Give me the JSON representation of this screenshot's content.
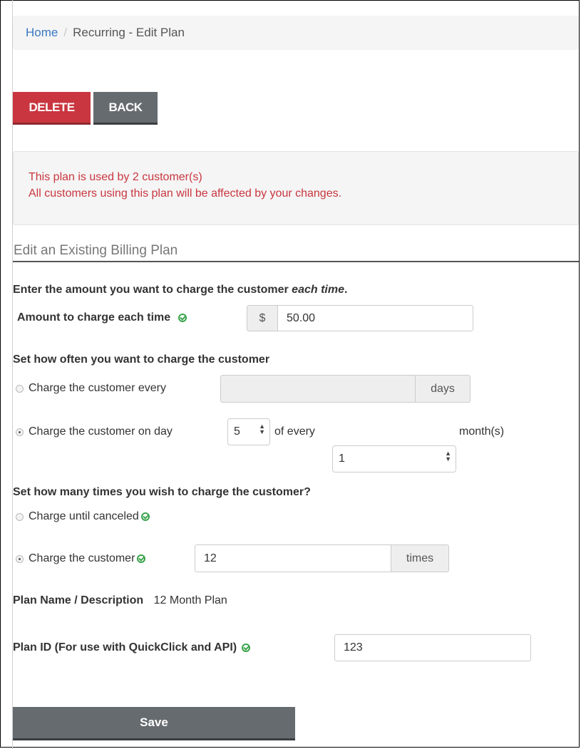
{
  "breadcrumb": {
    "home": "Home",
    "separator": "/",
    "current": "Recurring - Edit Plan"
  },
  "actions": {
    "delete_label": "DELETE",
    "back_label": "BACK"
  },
  "alert": {
    "line1": "This plan is used by 2 customer(s)",
    "line2": "All customers using this plan will be affected by your changes."
  },
  "form": {
    "title": "Edit an Existing Billing Plan",
    "amount_section": {
      "heading_prefix": "Enter the amount you want to charge the customer ",
      "heading_emphasis": "each time",
      "heading_suffix": ".",
      "label": "Amount to charge each time",
      "currency": "$",
      "value": "50.00"
    },
    "frequency_section": {
      "heading": "Set how often you want to charge the customer",
      "option_days": {
        "label": "Charge the customer every",
        "value": "",
        "unit": "days",
        "selected": false
      },
      "option_monthly": {
        "label": "Charge the customer on day",
        "day_value": "5",
        "middle_label": "of every",
        "month_value": "1",
        "unit": "month(s)",
        "selected": true
      }
    },
    "times_section": {
      "heading": "Set how many times you wish to charge the customer?",
      "option_until_canceled": {
        "label": "Charge until canceled",
        "selected": false
      },
      "option_count": {
        "label": "Charge the customer",
        "value": "12",
        "unit": "times",
        "selected": true
      }
    },
    "plan_name": {
      "label": "Plan Name / Description",
      "value": "12 Month Plan"
    },
    "plan_id": {
      "label": "Plan ID (For use with QuickClick and API)",
      "value": "123"
    },
    "save_label": "Save"
  },
  "colors": {
    "danger": "#c9363f",
    "neutral_button": "#666b6f",
    "link": "#3a78c3",
    "valid_check": "#3aa34a"
  }
}
